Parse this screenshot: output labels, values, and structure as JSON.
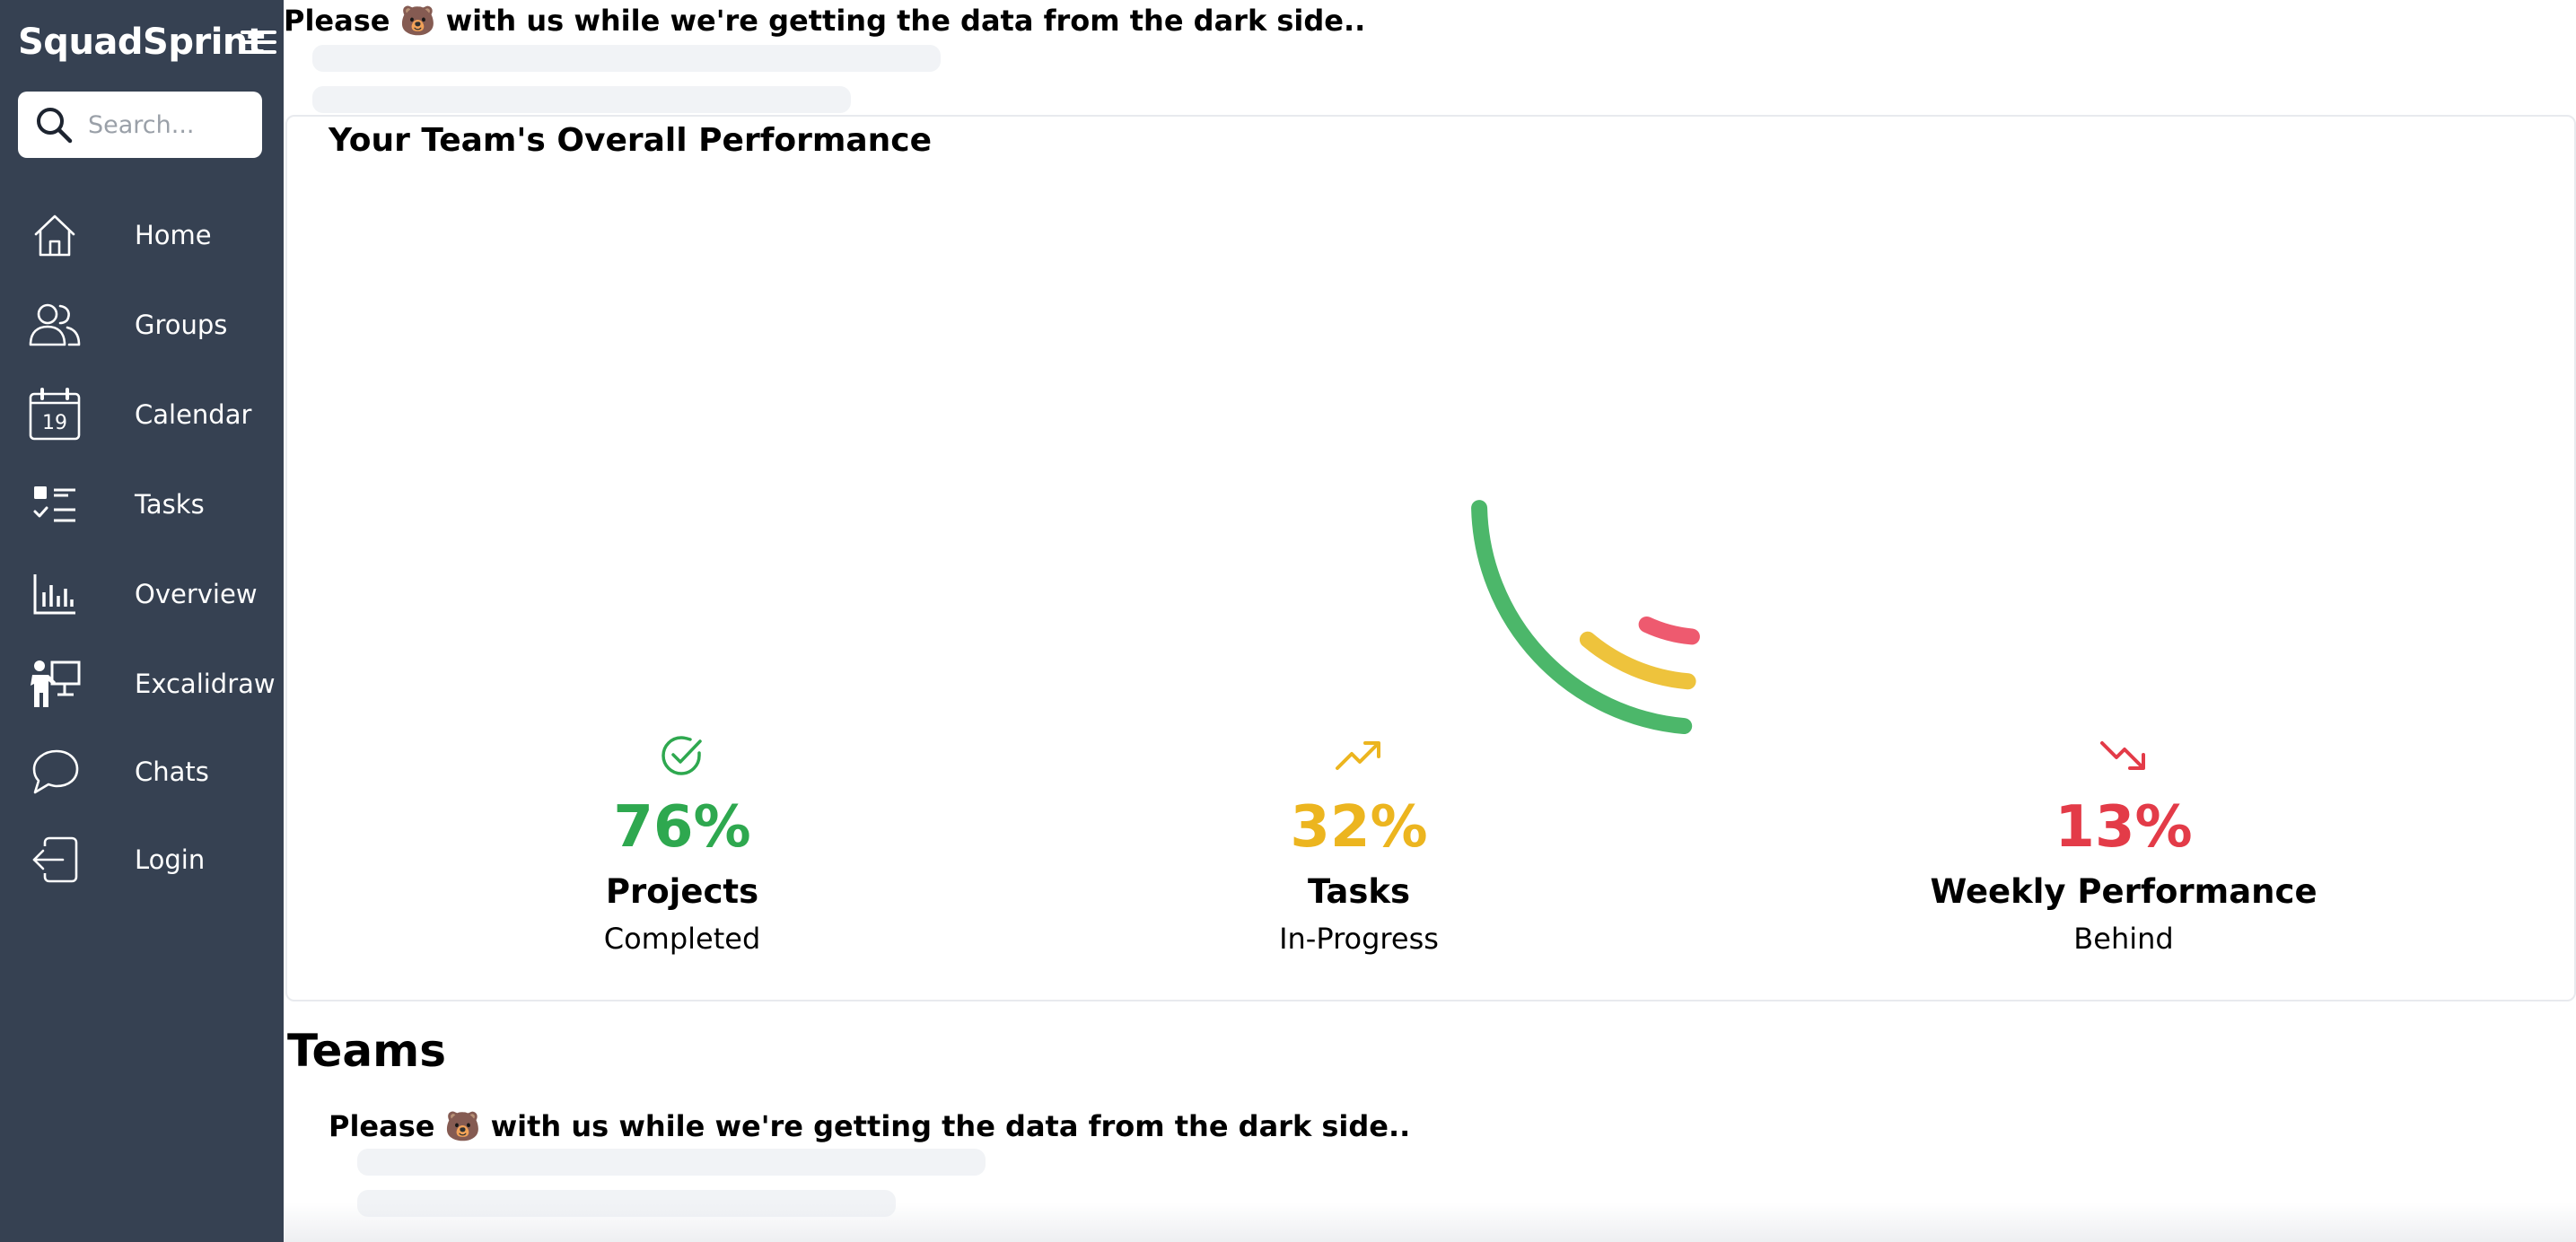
{
  "app": {
    "brand": "SquadSprint"
  },
  "search": {
    "placeholder": "Search..."
  },
  "sidebar": {
    "items": [
      {
        "label": "Home",
        "icon": "home-icon"
      },
      {
        "label": "Groups",
        "icon": "users-icon"
      },
      {
        "label": "Calendar",
        "icon": "calendar-icon",
        "icon_text": "19"
      },
      {
        "label": "Tasks",
        "icon": "tasks-icon"
      },
      {
        "label": "Overview",
        "icon": "bar-chart-icon"
      },
      {
        "label": "Excalidraw",
        "icon": "presenter-icon"
      },
      {
        "label": "Chats",
        "icon": "chat-icon"
      },
      {
        "label": "Login",
        "icon": "login-icon"
      }
    ]
  },
  "loading": {
    "message_top": "Please 🐻 with us while we're getting the data from the dark side..",
    "message_teams": "Please 🐻 with us while we're getting the data from the dark side.."
  },
  "performance": {
    "title": "Your Team's Overall Performance",
    "stats": [
      {
        "value": "76%",
        "fraction": 0.76,
        "name": "Projects",
        "sub": "Completed",
        "color": "#2ea84f",
        "icon": "check-circle-icon"
      },
      {
        "value": "32%",
        "fraction": 0.32,
        "name": "Tasks",
        "sub": "In-Progress",
        "color": "#ecb51f",
        "icon": "trending-up-icon"
      },
      {
        "value": "13%",
        "fraction": 0.13,
        "name": "Weekly Performance",
        "sub": "Behind",
        "color": "#e33b48",
        "icon": "trending-down-icon"
      }
    ]
  },
  "teams": {
    "title": "Teams"
  },
  "colors": {
    "sidebar_bg": "#364152",
    "arc_green": "#4cb76a",
    "arc_yellow": "#eec33c",
    "arc_red": "#ee5a6f"
  }
}
